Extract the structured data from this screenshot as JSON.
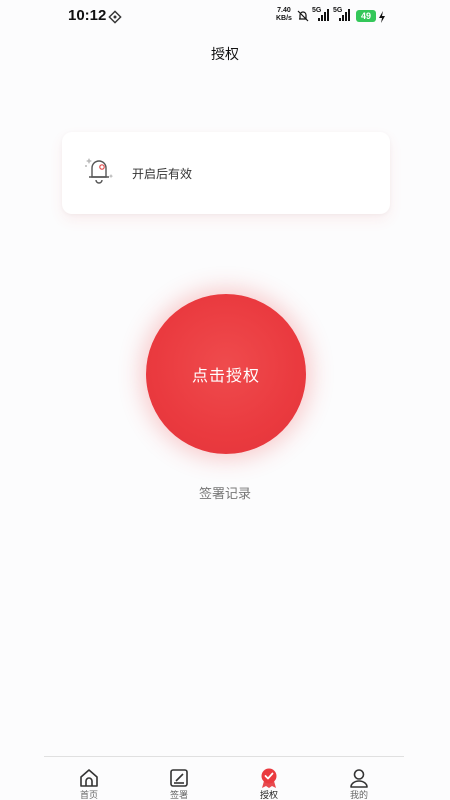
{
  "status_bar": {
    "time": "10:12",
    "net_speed_value": "7.40",
    "net_speed_unit": "KB/s",
    "signal1_label": "5G",
    "signal2_label": "5G",
    "battery": "49"
  },
  "header": {
    "title": "授权"
  },
  "notice": {
    "text": "开启后有效"
  },
  "main": {
    "authorize_label": "点击授权",
    "records_link": "签署记录"
  },
  "colors": {
    "accent": "#ea3a3f",
    "battery": "#34c759"
  },
  "bottom_nav": {
    "items": [
      {
        "label": "首页",
        "icon": "home-icon"
      },
      {
        "label": "签署",
        "icon": "sign-icon"
      },
      {
        "label": "授权",
        "icon": "authorize-badge-icon"
      },
      {
        "label": "我的",
        "icon": "user-icon"
      }
    ],
    "active": "授权"
  }
}
